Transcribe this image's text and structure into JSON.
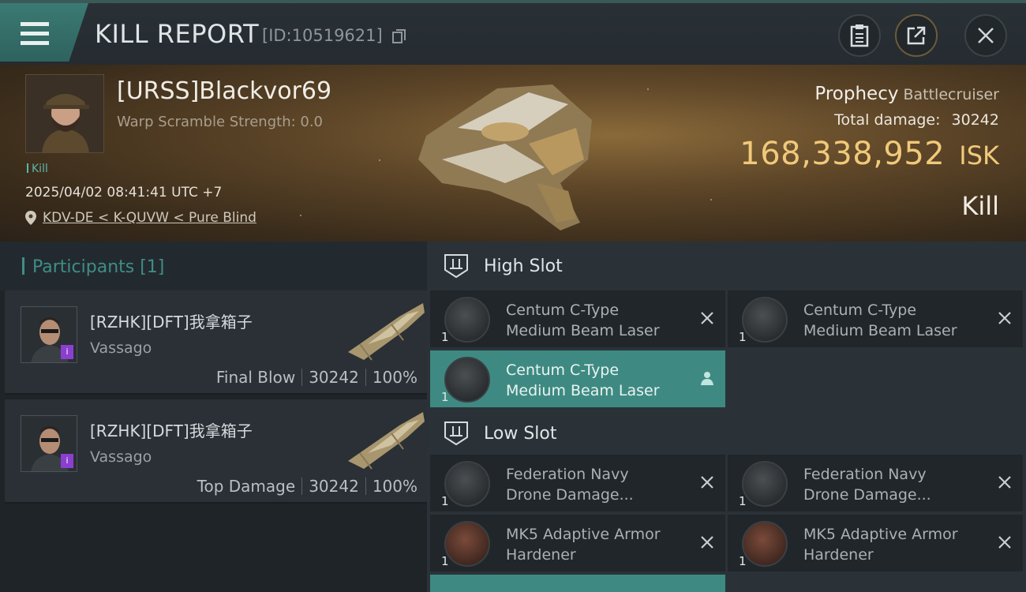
{
  "header": {
    "title": "KILL REPORT",
    "report_id": "[ID:10519621]",
    "icons": [
      "menu-icon",
      "copy-icon",
      "clipboard-icon",
      "share-icon",
      "close-icon"
    ]
  },
  "victim": {
    "name": "[URSS]Blackvor69",
    "warp_scramble": "Warp Scramble Strength: 0.0",
    "kill_tag": "Kill",
    "datetime": "2025/04/02 08:41:41 UTC +7",
    "location": "KDV-DE < K-QUVW < Pure Blind",
    "ship_name": "Prophecy",
    "ship_class": "Battlecruiser",
    "total_damage_label": "Total damage:",
    "total_damage": "30242",
    "isk_value": "168,338,952",
    "isk_unit": "ISK",
    "result": "Kill"
  },
  "participants": {
    "title": "Participants [1]",
    "rows": [
      {
        "name": "[RZHK][DFT]我拿箱子",
        "ship": "Vassago",
        "role": "Final Blow",
        "damage": "30242",
        "percent": "100%"
      },
      {
        "name": "[RZHK][DFT]我拿箱子",
        "ship": "Vassago",
        "role": "Top Damage",
        "damage": "30242",
        "percent": "100%"
      }
    ]
  },
  "fitting": {
    "high_slot": {
      "title": "High Slot",
      "modules": [
        {
          "line1": "Centum C-Type",
          "line2": "Medium Beam Laser",
          "qty": "1",
          "action": "destroyed"
        },
        {
          "line1": "Centum C-Type",
          "line2": "Medium Beam Laser",
          "qty": "1",
          "action": "destroyed"
        },
        {
          "line1": "Centum C-Type",
          "line2": "Medium Beam Laser",
          "qty": "1",
          "action": "dropped"
        }
      ]
    },
    "low_slot": {
      "title": "Low Slot",
      "modules": [
        {
          "line1": "Federation Navy",
          "line2": "Drone Damage...",
          "qty": "1",
          "action": "destroyed"
        },
        {
          "line1": "Federation Navy",
          "line2": "Drone Damage...",
          "qty": "1",
          "action": "destroyed"
        },
        {
          "line1": "MK5 Adaptive Armor",
          "line2": "Hardener",
          "qty": "1",
          "action": "destroyed"
        },
        {
          "line1": "MK5 Adaptive Armor",
          "line2": "Hardener",
          "qty": "1",
          "action": "destroyed"
        }
      ]
    }
  },
  "colors": {
    "accent_teal": "#3e8a82",
    "isk_gold": "#f0c97a",
    "badge_purple": "#8b3fd0"
  }
}
